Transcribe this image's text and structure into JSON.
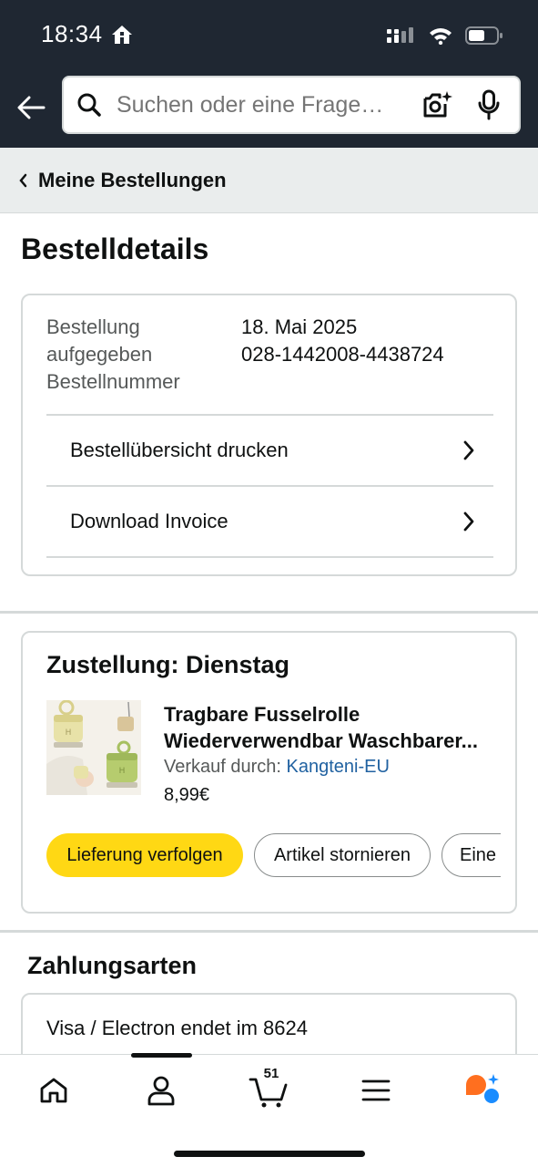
{
  "status_bar": {
    "time": "18:34"
  },
  "search": {
    "placeholder": "Suchen oder eine Frage…"
  },
  "breadcrumb": {
    "label": "Meine Bestellungen"
  },
  "page": {
    "title": "Bestelldetails"
  },
  "order_info": {
    "placed_label": "Bestellung aufgegeben",
    "placed_label_line1": "Bestellung",
    "placed_label_line2": "aufgegeben",
    "date": "18. Mai 2025",
    "number_label": "Bestellnummer",
    "number": "028-1442008-4438724",
    "links": [
      {
        "label": "Bestellübersicht drucken"
      },
      {
        "label": "Download Invoice"
      }
    ]
  },
  "delivery": {
    "title": "Zustellung: Dienstag",
    "product": {
      "title_line1": "Tragbare Fusselrolle",
      "title_line2": "Wiederverwendbar Waschbarer...",
      "seller_prefix": "Verkauf durch:",
      "seller_name": "Kangteni-EU",
      "price": "8,99€"
    },
    "buttons": {
      "track": "Lieferung verfolgen",
      "cancel": "Artikel stornieren",
      "more": "Eine"
    }
  },
  "payment": {
    "title": "Zahlungsarten",
    "method": "Visa / Electron  endet im 8624"
  },
  "nav": {
    "cart_count": "51"
  },
  "colors": {
    "header_bg": "#1f2732",
    "primary_button": "#ffd814",
    "link": "#2162a1",
    "rufus_orange": "#ff6f1f",
    "rufus_blue": "#1a8cff"
  }
}
